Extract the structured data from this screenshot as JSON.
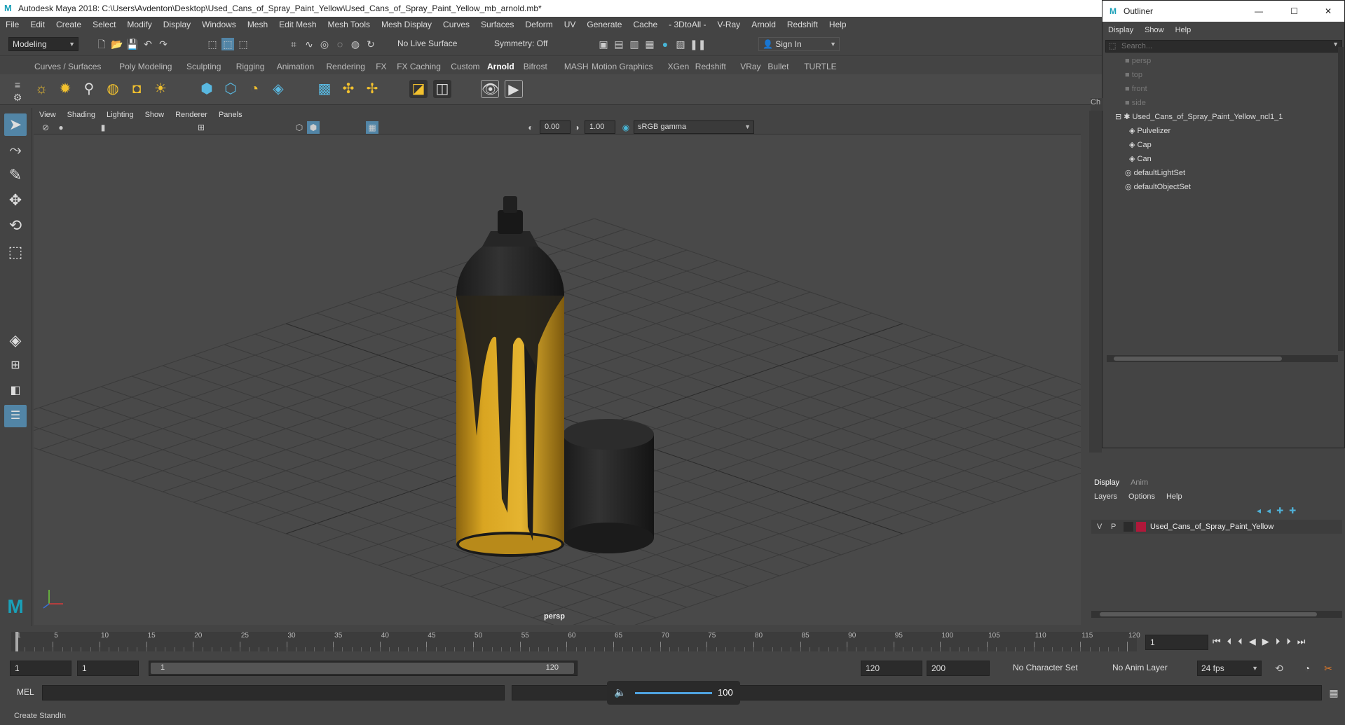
{
  "window": {
    "title": "Autodesk Maya 2018: C:\\Users\\Avdenton\\Desktop\\Used_Cans_of_Spray_Paint_Yellow\\Used_Cans_of_Spray_Paint_Yellow_mb_arnold.mb*"
  },
  "menubar": [
    "File",
    "Edit",
    "Create",
    "Select",
    "Modify",
    "Display",
    "Windows",
    "Mesh",
    "Edit Mesh",
    "Mesh Tools",
    "Mesh Display",
    "Curves",
    "Surfaces",
    "Deform",
    "UV",
    "Generate",
    "Cache",
    "- 3DtoAll -",
    "V-Ray",
    "Arnold",
    "Redshift",
    "Help"
  ],
  "toolbar": {
    "mode": "Modeling",
    "live_surface": "No Live Surface",
    "symmetry": "Symmetry: Off",
    "sign_in": "Sign In"
  },
  "shelf_tabs": [
    "Curves / Surfaces",
    "Poly Modeling",
    "Sculpting",
    "Rigging",
    "Animation",
    "Rendering",
    "FX",
    "FX Caching",
    "Custom",
    "Arnold",
    "Bifrost",
    "MASH",
    "Motion Graphics",
    "XGen",
    "Redshift",
    "VRay",
    "Bullet",
    "TURTLE"
  ],
  "shelf_active": "Arnold",
  "viewport": {
    "menu": [
      "View",
      "Shading",
      "Lighting",
      "Show",
      "Renderer",
      "Panels"
    ],
    "exposure": "0.00",
    "gamma": "1.00",
    "color_space": "sRGB gamma",
    "camera_label": "persp"
  },
  "outliner": {
    "title": "Outliner",
    "menu": [
      "Display",
      "Show",
      "Help"
    ],
    "search_placeholder": "Search...",
    "cameras": [
      "persp",
      "top",
      "front",
      "side"
    ],
    "group": "Used_Cans_of_Spray_Paint_Yellow_ncl1_1",
    "children": [
      "Pulvelizer",
      "Cap",
      "Can"
    ],
    "sets": [
      "defaultLightSet",
      "defaultObjectSet"
    ],
    "side_tab": "Ch"
  },
  "layer_editor": {
    "tabs": [
      "Display",
      "Anim"
    ],
    "menu": [
      "Layers",
      "Options",
      "Help"
    ],
    "layer": {
      "v": "V",
      "p": "P",
      "name": "Used_Cans_of_Spray_Paint_Yellow",
      "color": "#b0183a"
    }
  },
  "timeline": {
    "ticks": [
      "1",
      "5",
      "10",
      "15",
      "20",
      "25",
      "30",
      "35",
      "40",
      "45",
      "50",
      "55",
      "60",
      "65",
      "70",
      "75",
      "80",
      "85",
      "90",
      "95",
      "100",
      "105",
      "110",
      "115",
      "120"
    ],
    "current_frame": "1"
  },
  "range": {
    "start": "1",
    "inner_start": "1",
    "slider_start": "1",
    "slider_end": "120",
    "end": "120",
    "max": "200",
    "character_set": "No Character Set",
    "anim_layer": "No Anim Layer",
    "fps": "24 fps"
  },
  "cmdline": {
    "lang": "MEL",
    "volume": "100"
  },
  "helpline": {
    "text": "Create StandIn"
  },
  "colors": {
    "accent": "#5285a6",
    "maya_logo": "#1aa0b8",
    "can_yellow": "#d9a521"
  }
}
